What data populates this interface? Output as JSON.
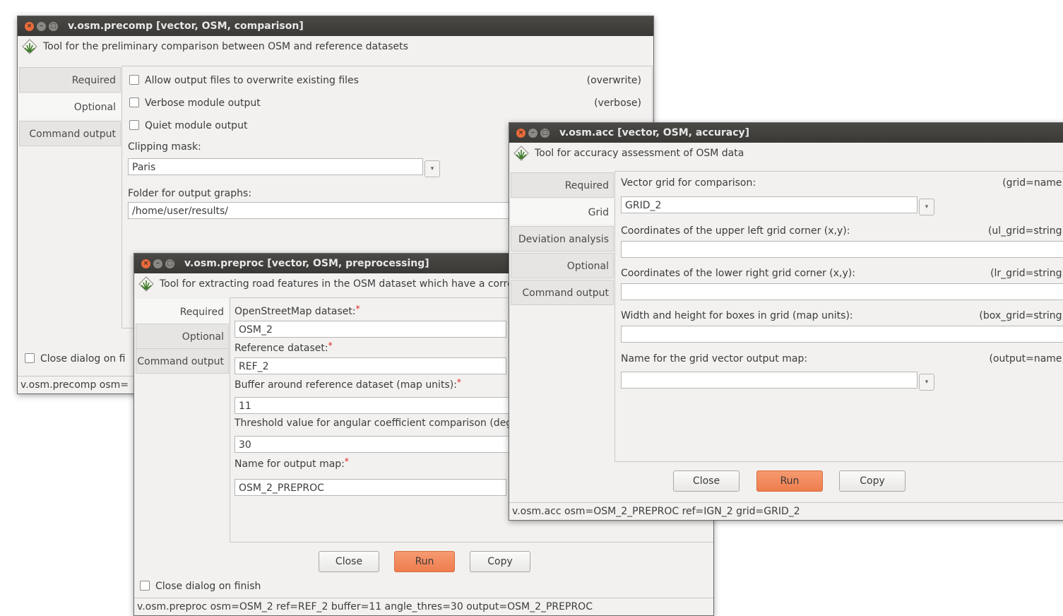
{
  "precomp": {
    "title": "v.osm.precomp [vector, OSM, comparison]",
    "description": "Tool for the preliminary comparison between OSM and reference datasets",
    "tabs": [
      "Required",
      "Optional",
      "Command output"
    ],
    "options": [
      {
        "label": "Allow output files to overwrite existing files",
        "key": "(overwrite)"
      },
      {
        "label": "Verbose module output",
        "key": "(verbose)"
      },
      {
        "label": "Quiet module output",
        "key": ""
      }
    ],
    "clipping_label": "Clipping mask:",
    "clipping_value": "Paris",
    "folder_label": "Folder for output graphs:",
    "folder_value": "/home/user/results/",
    "close_on_finish": "Close dialog on fi",
    "status": "v.osm.precomp osm="
  },
  "preproc": {
    "title": "v.osm.preproc [vector, OSM, preprocessing]",
    "description": "Tool for extracting road features in the OSM dataset which have a corres",
    "tabs": [
      "Required",
      "Optional",
      "Command output"
    ],
    "fields": [
      {
        "label": "OpenStreetMap dataset:",
        "value": "OSM_2",
        "required": "*"
      },
      {
        "label": "Reference dataset:",
        "value": "REF_2",
        "required": "*"
      },
      {
        "label": "Buffer around reference dataset (map units):",
        "value": "11",
        "required": "*"
      },
      {
        "label": "Threshold value for angular coefficient comparison (degr",
        "value": "30",
        "required": ""
      },
      {
        "label": "Name for output map:",
        "value": "OSM_2_PREPROC",
        "required": "*"
      }
    ],
    "buttons": {
      "close": "Close",
      "run": "Run",
      "copy": "Copy"
    },
    "close_on_finish": "Close dialog on finish",
    "status": "v.osm.preproc osm=OSM_2 ref=REF_2 buffer=11 angle_thres=30 output=OSM_2_PREPROC"
  },
  "acc": {
    "title": "v.osm.acc [vector, OSM, accuracy]",
    "description": "Tool for accuracy assessment of OSM data",
    "tabs": [
      "Required",
      "Grid",
      "Deviation analysis",
      "Optional",
      "Command output"
    ],
    "fields": [
      {
        "label": "Vector grid for comparison:",
        "key": "(grid=name)",
        "value": "GRID_2"
      },
      {
        "label": "Coordinates of the upper left grid corner (x,y):",
        "key": "(ul_grid=string)",
        "value": ""
      },
      {
        "label": "Coordinates of the lower right grid corner (x,y):",
        "key": "(lr_grid=string)",
        "value": ""
      },
      {
        "label": "Width and height for boxes in grid (map units):",
        "key": "(box_grid=string)",
        "value": ""
      },
      {
        "label": "Name for the grid vector output map:",
        "key": "(output=name)",
        "value": ""
      }
    ],
    "buttons": {
      "close": "Close",
      "run": "Run",
      "copy": "Copy"
    },
    "status": "v.osm.acc osm=OSM_2_PREPROC ref=IGN_2 grid=GRID_2"
  },
  "icons": {
    "dropdown": "▾",
    "close": "×",
    "minimize": "–",
    "maximize": "□"
  },
  "colors": {
    "titlebar": "#3c3b37",
    "run_button": "#f08a5d",
    "close_button": "#e86b3c",
    "required_star": "#e02020"
  }
}
